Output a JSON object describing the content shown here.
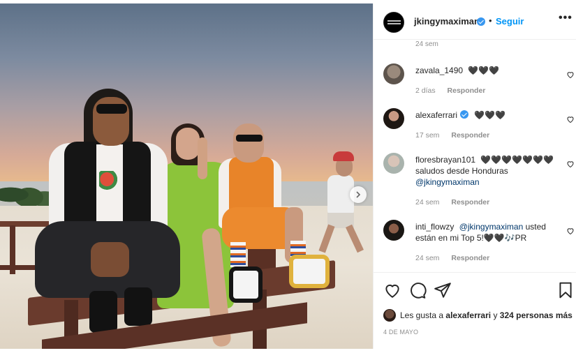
{
  "header": {
    "username": "jkingymaximan",
    "separator": "•",
    "follow_label": "Seguir",
    "more_label": "•••"
  },
  "top_time": "24 sem",
  "comments": [
    {
      "username": "zavala_1490",
      "text": "🖤🖤🖤",
      "time": "2 días",
      "reply_label": "Responder",
      "verified": false
    },
    {
      "username": "alexaferrari",
      "text": "🖤🖤🖤",
      "time": "17 sem",
      "reply_label": "Responder",
      "verified": true
    },
    {
      "username": "floresbrayan101",
      "text": "🖤🖤🖤🖤🖤🖤🖤",
      "text2": "saludos desde Honduras",
      "mention": "@jkingymaximan",
      "time": "24 sem",
      "reply_label": "Responder",
      "verified": false
    },
    {
      "username": "inti_flowzy",
      "mention": "@jkingymaximan",
      "text": "usted",
      "text2": "están en mi Top 5!🖤🖤🎶PR",
      "time": "24 sem",
      "reply_label": "Responder",
      "verified": false
    }
  ],
  "likes": {
    "prefix": "Les gusta a",
    "user": "alexaferrari",
    "middle": "y",
    "count": "324 personas más"
  },
  "date": "4 DE MAYO",
  "icons": [
    "heart-icon",
    "comment-icon",
    "share-icon",
    "bookmark-icon",
    "chevron-right-icon",
    "verified-icon"
  ],
  "colors": {
    "follow": "#0095f6",
    "verified": "#3897f0",
    "muted": "#8e8e8e",
    "mention": "#00376b"
  }
}
